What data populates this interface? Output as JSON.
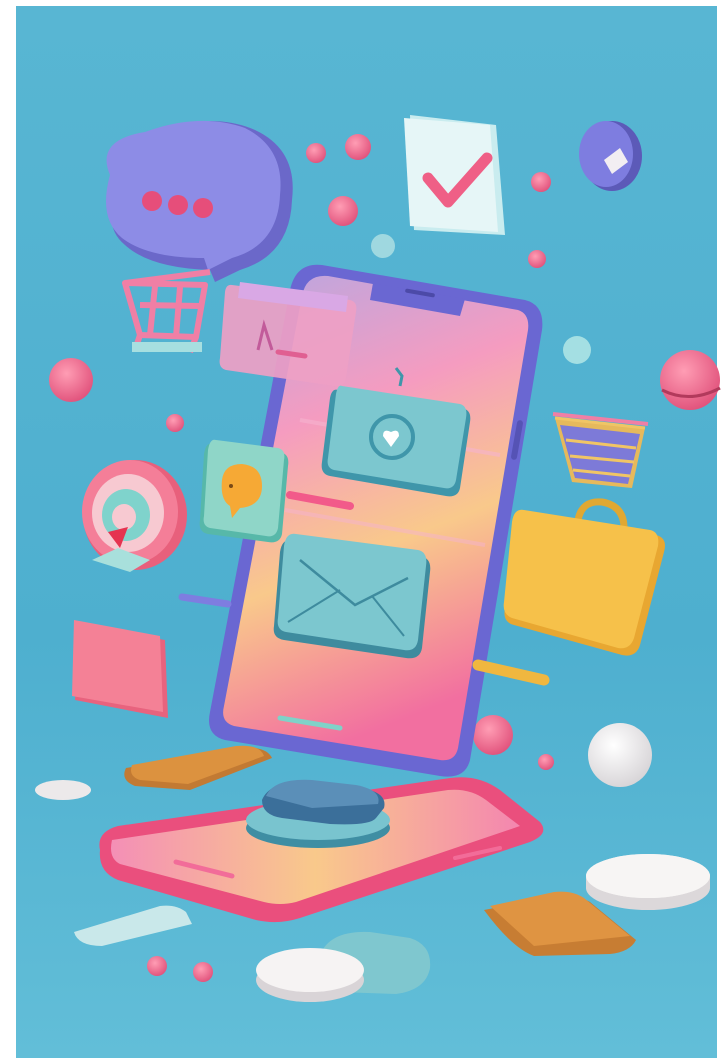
{
  "scene": {
    "subject": "3d-mobile-marketing-illustration",
    "palette": {
      "background": "#4fb0cf",
      "background_light": "#6cc3dc",
      "phone_body": "#6f6fd8",
      "screen_pink": "#f38fb6",
      "screen_yellow": "#f9c97a",
      "teal_card": "#7cc7cf",
      "lavender": "#8f8ee6",
      "coral": "#f06d87",
      "golden": "#f0b73f",
      "check_pink": "#ef5f86",
      "white_disc": "#f4f1f0",
      "brown_tile": "#d98a3a"
    },
    "icons": [
      "chat-bubble-icon",
      "check-card-icon",
      "shopping-cart-icon",
      "badge-icon",
      "profile-card-icon",
      "heart-folder-icon",
      "chat-icon",
      "target-icon",
      "envelope-icon",
      "shopping-basket-icon",
      "briefcase-icon"
    ]
  }
}
